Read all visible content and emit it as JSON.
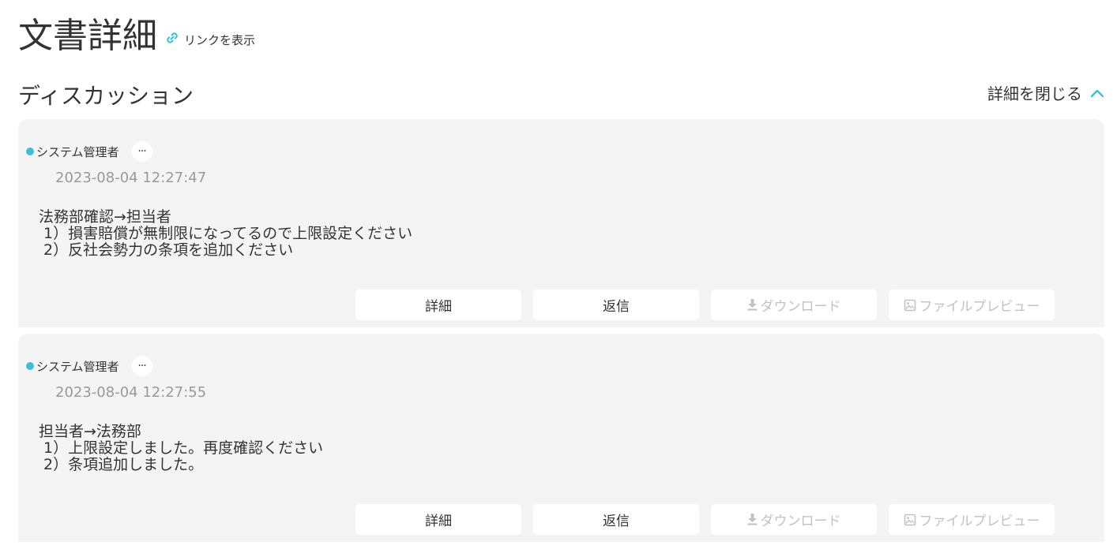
{
  "header": {
    "title": "文書詳細",
    "show_link_label": "リンクを表示",
    "link_icon": "link-icon"
  },
  "discussion": {
    "title": "ディスカッション",
    "toggle_label": "詳細を閉じる",
    "toggle_icon": "chevron-up-icon",
    "accent_color": "#3cbfd6",
    "messages": [
      {
        "author": "システム管理者",
        "more_label": "···",
        "timestamp": "2023-08-04 12:27:47",
        "lines": [
          "法務部確認→担当者",
          " 1）損害賠償が無制限になってるので上限設定ください",
          " 2）反社会勢力の条項を追加ください"
        ],
        "buttons": {
          "detail": "詳細",
          "reply": "返信",
          "download": "ダウンロード",
          "preview": "ファイルプレビュー"
        }
      },
      {
        "author": "システム管理者",
        "more_label": "···",
        "timestamp": "2023-08-04 12:27:55",
        "lines": [
          "担当者→法務部",
          " 1）上限設定しました。再度確認ください",
          " 2）条項追加しました。"
        ],
        "buttons": {
          "detail": "詳細",
          "reply": "返信",
          "download": "ダウンロード",
          "preview": "ファイルプレビュー"
        }
      }
    ]
  }
}
